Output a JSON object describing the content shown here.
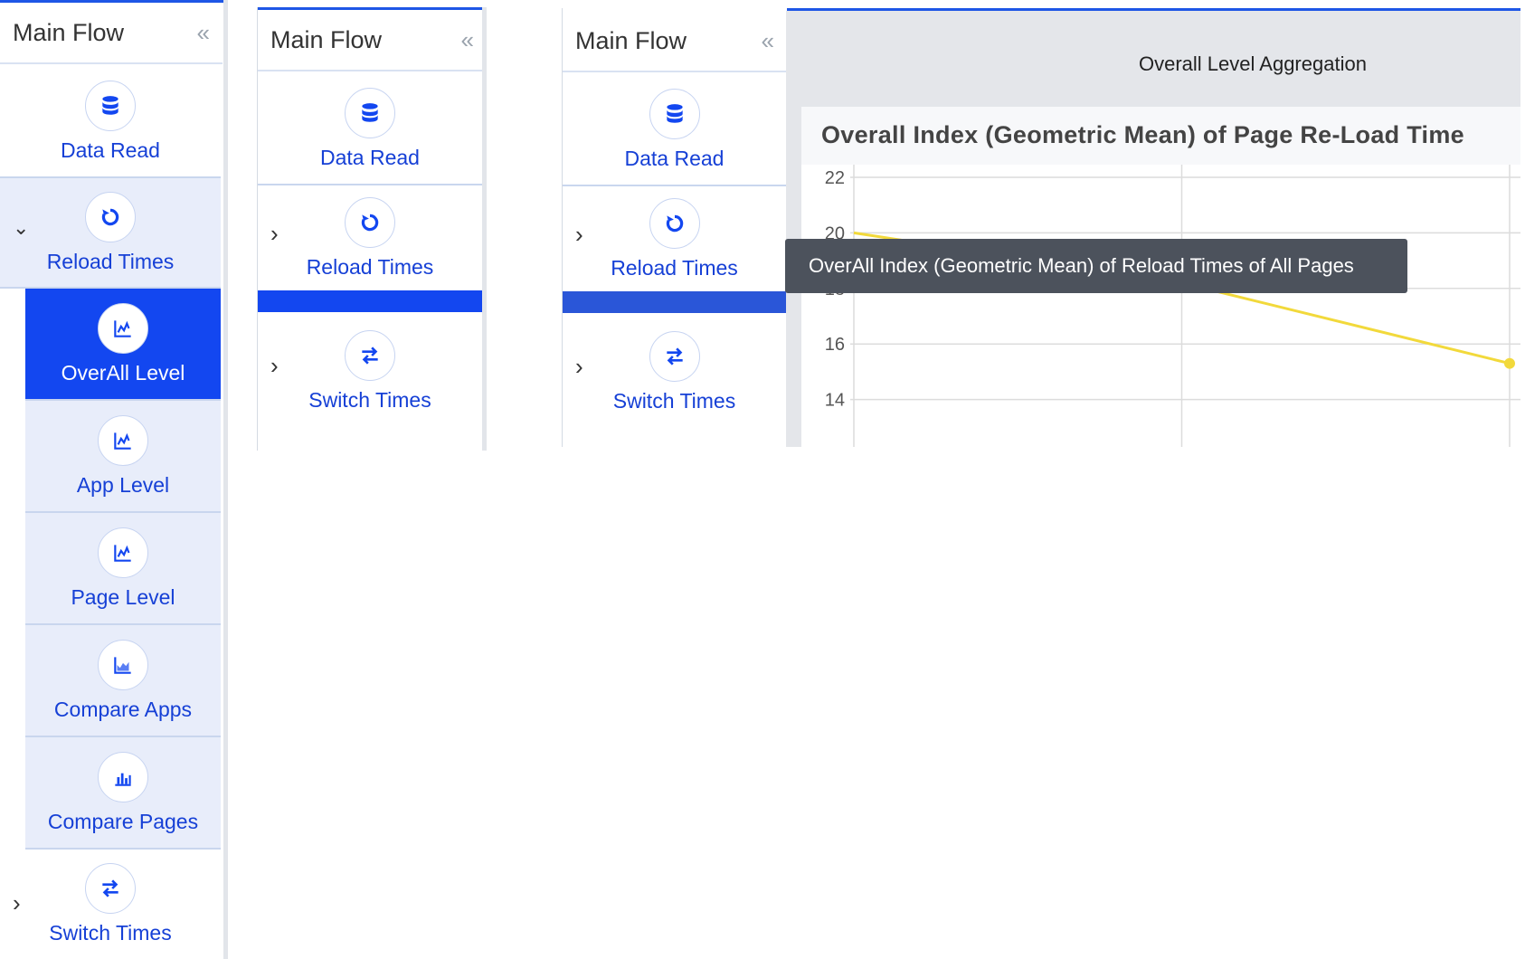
{
  "sidebar": {
    "title": "Main Flow",
    "collapse_glyph": "«",
    "items": {
      "data_read": {
        "label": "Data Read",
        "icon": "database-icon"
      },
      "reload_times": {
        "label": "Reload Times",
        "icon": "reload-icon"
      },
      "overall_level": {
        "label": "OverAll Level",
        "icon": "line-chart-icon"
      },
      "app_level": {
        "label": "App Level",
        "icon": "line-chart-icon"
      },
      "page_level": {
        "label": "Page Level",
        "icon": "line-chart-icon"
      },
      "compare_apps": {
        "label": "Compare Apps",
        "icon": "area-chart-icon"
      },
      "compare_pages": {
        "label": "Compare Pages",
        "icon": "bar-chart-icon"
      },
      "switch_times": {
        "label": "Switch Times",
        "icon": "swap-arrows-icon"
      }
    },
    "chevron_right": "›",
    "chevron_down": "⌄"
  },
  "main": {
    "aggregation_title": "Overall Level Aggregation",
    "chart_title": "Overall Index (Geometric Mean) of Page Re-Load Time",
    "tooltip": "OverAll Index (Geometric Mean) of Reload Times of All Pages"
  },
  "colors": {
    "accent": "#1347f0",
    "link": "#1640d6",
    "series": "#f2d93b",
    "tooltip_bg": "#4c525c"
  },
  "chart_data": {
    "type": "line",
    "title": "Overall Index (Geometric Mean) of Page Re-Load Time",
    "y_ticks": [
      "22",
      "20",
      "18",
      "16",
      "14"
    ],
    "ylim": [
      14,
      22
    ],
    "series": [
      {
        "values": [
          20,
          18.2,
          15.3
        ]
      }
    ],
    "grid": true
  }
}
